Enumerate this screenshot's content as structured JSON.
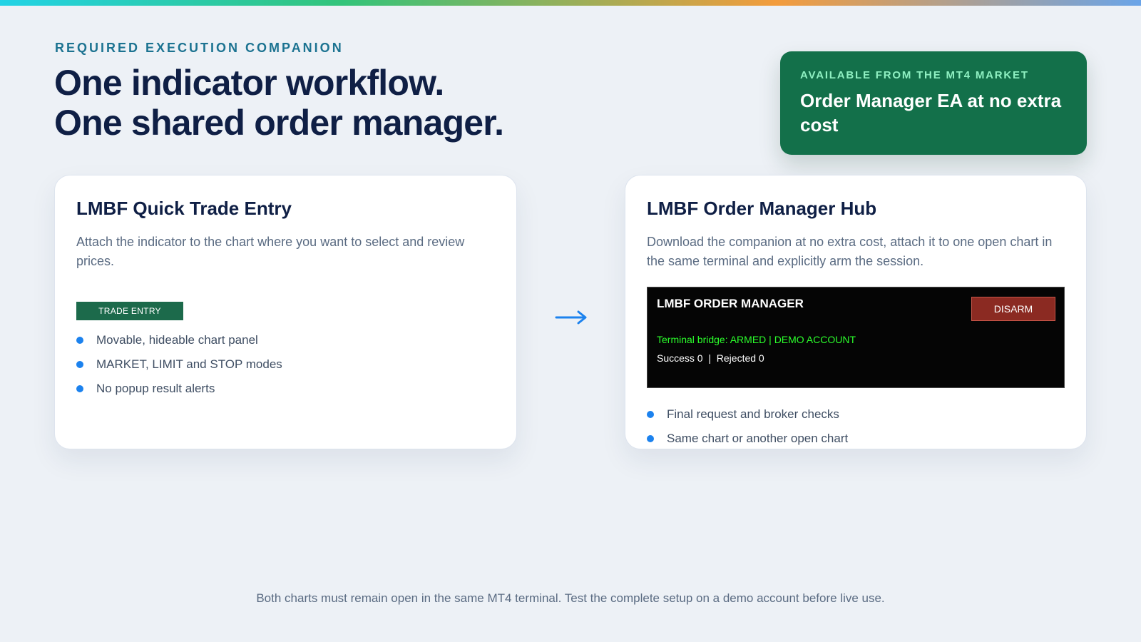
{
  "header": {
    "eyebrow": "REQUIRED EXECUTION COMPANION",
    "headline_line1": "One indicator workflow.",
    "headline_line2": "One shared order manager."
  },
  "promo": {
    "eyebrow": "AVAILABLE FROM THE MT4 MARKET",
    "title": "Order Manager EA at no extra cost"
  },
  "quick_trade_card": {
    "title": "LMBF Quick Trade Entry",
    "description": "Attach the indicator to the chart where you want to select and review prices.",
    "button_label": "TRADE ENTRY",
    "features": [
      "Movable, hideable chart panel",
      "MARKET, LIMIT and STOP modes",
      "No popup result alerts"
    ]
  },
  "order_manager_card": {
    "title": "LMBF Order Manager Hub",
    "description": "Download the companion at no extra cost, attach it to one open chart in the same terminal and explicitly arm the session.",
    "panel": {
      "title": "LMBF ORDER MANAGER",
      "disarm_label": "DISARM",
      "status": "Terminal bridge: ARMED | DEMO ACCOUNT",
      "counts": "Success 0  |  Rejected 0"
    },
    "features": [
      "Final request and broker checks",
      "Same chart or another open chart"
    ]
  },
  "footnote": "Both charts must remain open in the same MT4 terminal. Test the complete setup on a demo account before live use.",
  "icons": {
    "flow_arrow": "arrow-right-icon",
    "bullet": "bullet-dot-icon"
  },
  "colors": {
    "accent_blue": "#1c82ee",
    "headline_navy": "#0f1f45",
    "promo_green": "#13704a",
    "panel_armed_green": "#2bff2b",
    "disarm_red": "#8b2a22",
    "gradient": [
      "#22d3e6",
      "#33c47a",
      "#f39c3c",
      "#6aa4e8"
    ]
  }
}
